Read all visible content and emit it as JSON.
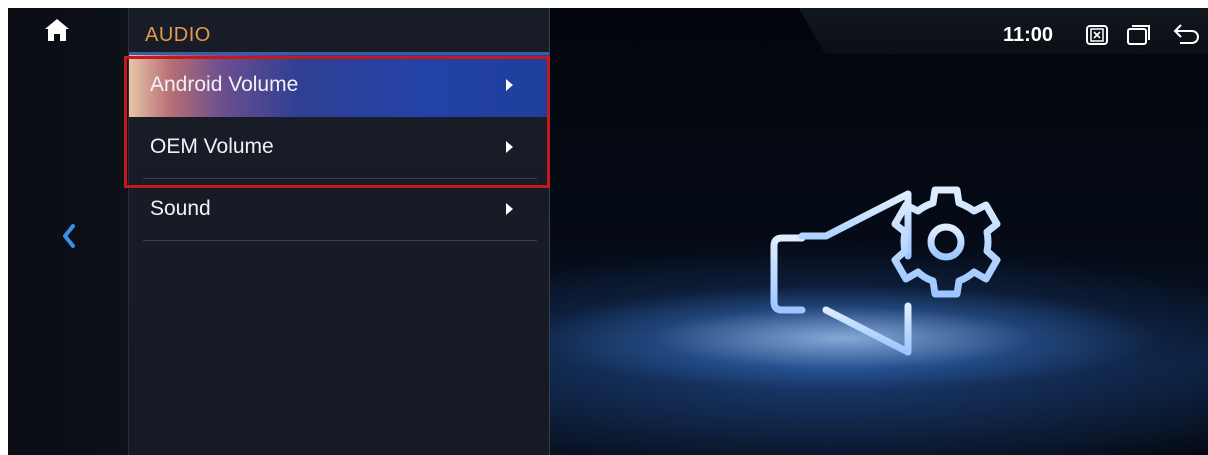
{
  "panel": {
    "title": "AUDIO",
    "items": [
      {
        "label": "Android Volume",
        "active": true
      },
      {
        "label": "OEM Volume",
        "active": false
      },
      {
        "label": "Sound",
        "active": false
      }
    ]
  },
  "status_bar": {
    "time": "11:00",
    "icons": [
      "close-window-icon",
      "recent-apps-icon",
      "return-icon"
    ]
  },
  "nav": {
    "home_icon": "home-icon",
    "back_icon": "chevron-left-icon"
  },
  "hero_icon": "speaker-settings-icon",
  "colors": {
    "title_accent": "#e29a4e",
    "active_item": "#2342a8",
    "highlight_border": "#c51920",
    "back_arrow": "#3a8ef0"
  }
}
